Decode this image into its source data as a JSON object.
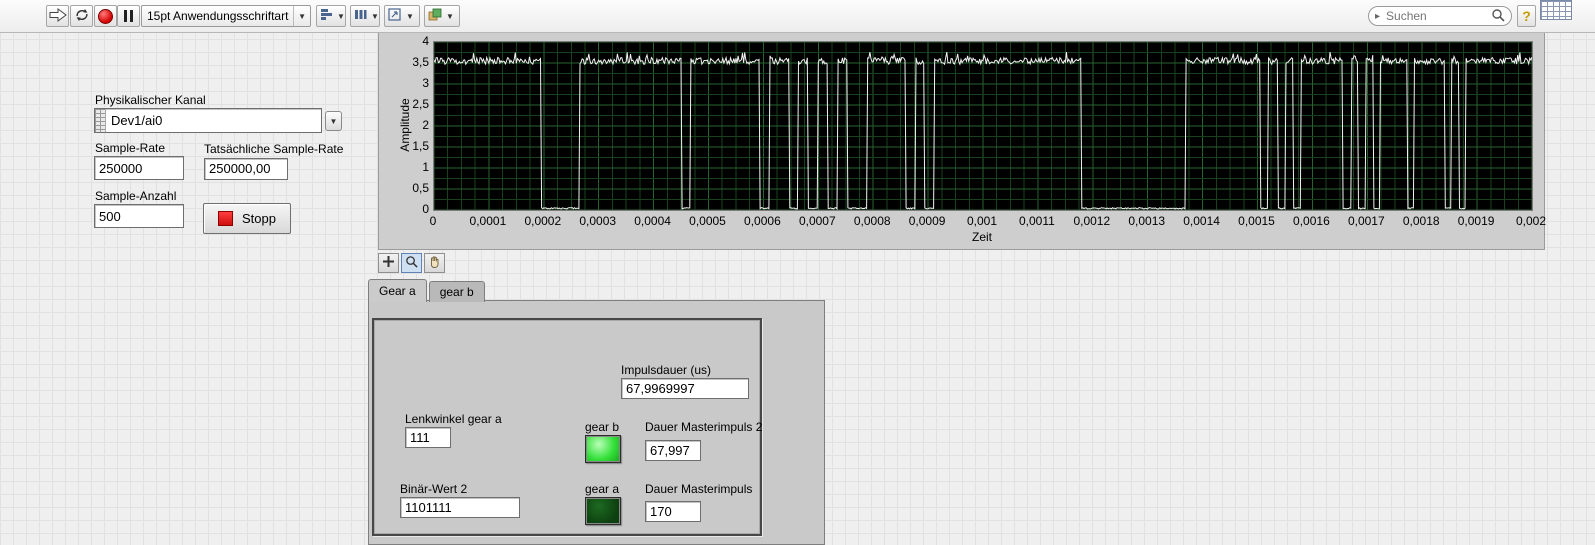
{
  "toolbar": {
    "font_selector": "15pt Anwendungsschriftart",
    "search_placeholder": "Suchen",
    "help_label": "?",
    "dropdown_arrow": "▼",
    "search_caret": "▸"
  },
  "controls": {
    "physical_channel": {
      "label": "Physikalischer Kanal",
      "value": "Dev1/ai0"
    },
    "sample_rate": {
      "label": "Sample-Rate",
      "value": "250000"
    },
    "actual_sample_rate": {
      "label": "Tatsächliche Sample-Rate",
      "value": "250000,00"
    },
    "sample_count": {
      "label": "Sample-Anzahl",
      "value": "500"
    },
    "stop_button": {
      "label": "Stopp"
    }
  },
  "chart_data": {
    "type": "line",
    "title": "",
    "xlabel": "Zeit",
    "ylabel": "Amplitude",
    "xlim": [
      0,
      0.002
    ],
    "ylim": [
      0,
      4
    ],
    "grid": true,
    "legend": false,
    "plot_bg": "#000000",
    "grid_color": "#17421d",
    "grid_color_major": "#27632f",
    "line_color": "#f2f2f2",
    "x_tick_labels": [
      "0",
      "0,0001",
      "0,0002",
      "0,0003",
      "0,0004",
      "0,0005",
      "0,0006",
      "0,0007",
      "0,0008",
      "0,0009",
      "0,001",
      "0,0011",
      "0,0012",
      "0,0013",
      "0,0014",
      "0,0015",
      "0,0016",
      "0,0017",
      "0,0018",
      "0,0019",
      "0,002"
    ],
    "y_tick_labels": [
      "0",
      "0,5",
      "1",
      "1,5",
      "2",
      "2,5",
      "3",
      "3,5",
      "4"
    ],
    "signal": {
      "description": "Digital pulse train (PWM-like) alternating between ~3.55 and 0",
      "high_level": 3.55,
      "low_level": 0.04,
      "high_intervals": [
        [
          0,
          0.000195
        ],
        [
          0.000265,
          0.000452
        ],
        [
          0.000468,
          0.000592
        ],
        [
          0.000612,
          0.000646
        ],
        [
          0.000663,
          0.000681
        ],
        [
          0.0007,
          0.000717
        ],
        [
          0.000735,
          0.000753
        ],
        [
          0.00079,
          0.000858
        ],
        [
          0.000877,
          0.000893
        ],
        [
          0.000912,
          0.001178
        ],
        [
          0.00137,
          0.001505
        ],
        [
          0.00152,
          0.001537
        ],
        [
          0.001552,
          0.001565
        ],
        [
          0.00158,
          0.001655
        ],
        [
          0.00167,
          0.001683
        ],
        [
          0.001697,
          0.00171
        ],
        [
          0.001724,
          0.001772
        ],
        [
          0.001786,
          0.00184
        ],
        [
          0.001853,
          0.001866
        ],
        [
          0.00188,
          0.002
        ]
      ]
    }
  },
  "tabs": [
    {
      "label": "Gear a",
      "selected": true
    },
    {
      "label": "gear b",
      "selected": false
    }
  ],
  "tab_page": {
    "impulsdauer": {
      "label": "Impulsdauer (us)",
      "value": "67,9969997"
    },
    "lenkwinkel_gear_a": {
      "label": "Lenkwinkel gear a",
      "value": "111"
    },
    "gear_b_led": {
      "label": "gear b",
      "on": true,
      "color_on": "#35e03a"
    },
    "dauer_masterimpuls_2": {
      "label": "Dauer Masterimpuls 2",
      "value": "67,997"
    },
    "binaer_wert_2": {
      "label": "Binär-Wert 2",
      "value": "1101111"
    },
    "gear_a_led": {
      "label": "gear a",
      "on": false,
      "color_off": "#0d3f10"
    },
    "dauer_masterimpuls": {
      "label": "Dauer Masterimpuls",
      "value": "170"
    }
  }
}
